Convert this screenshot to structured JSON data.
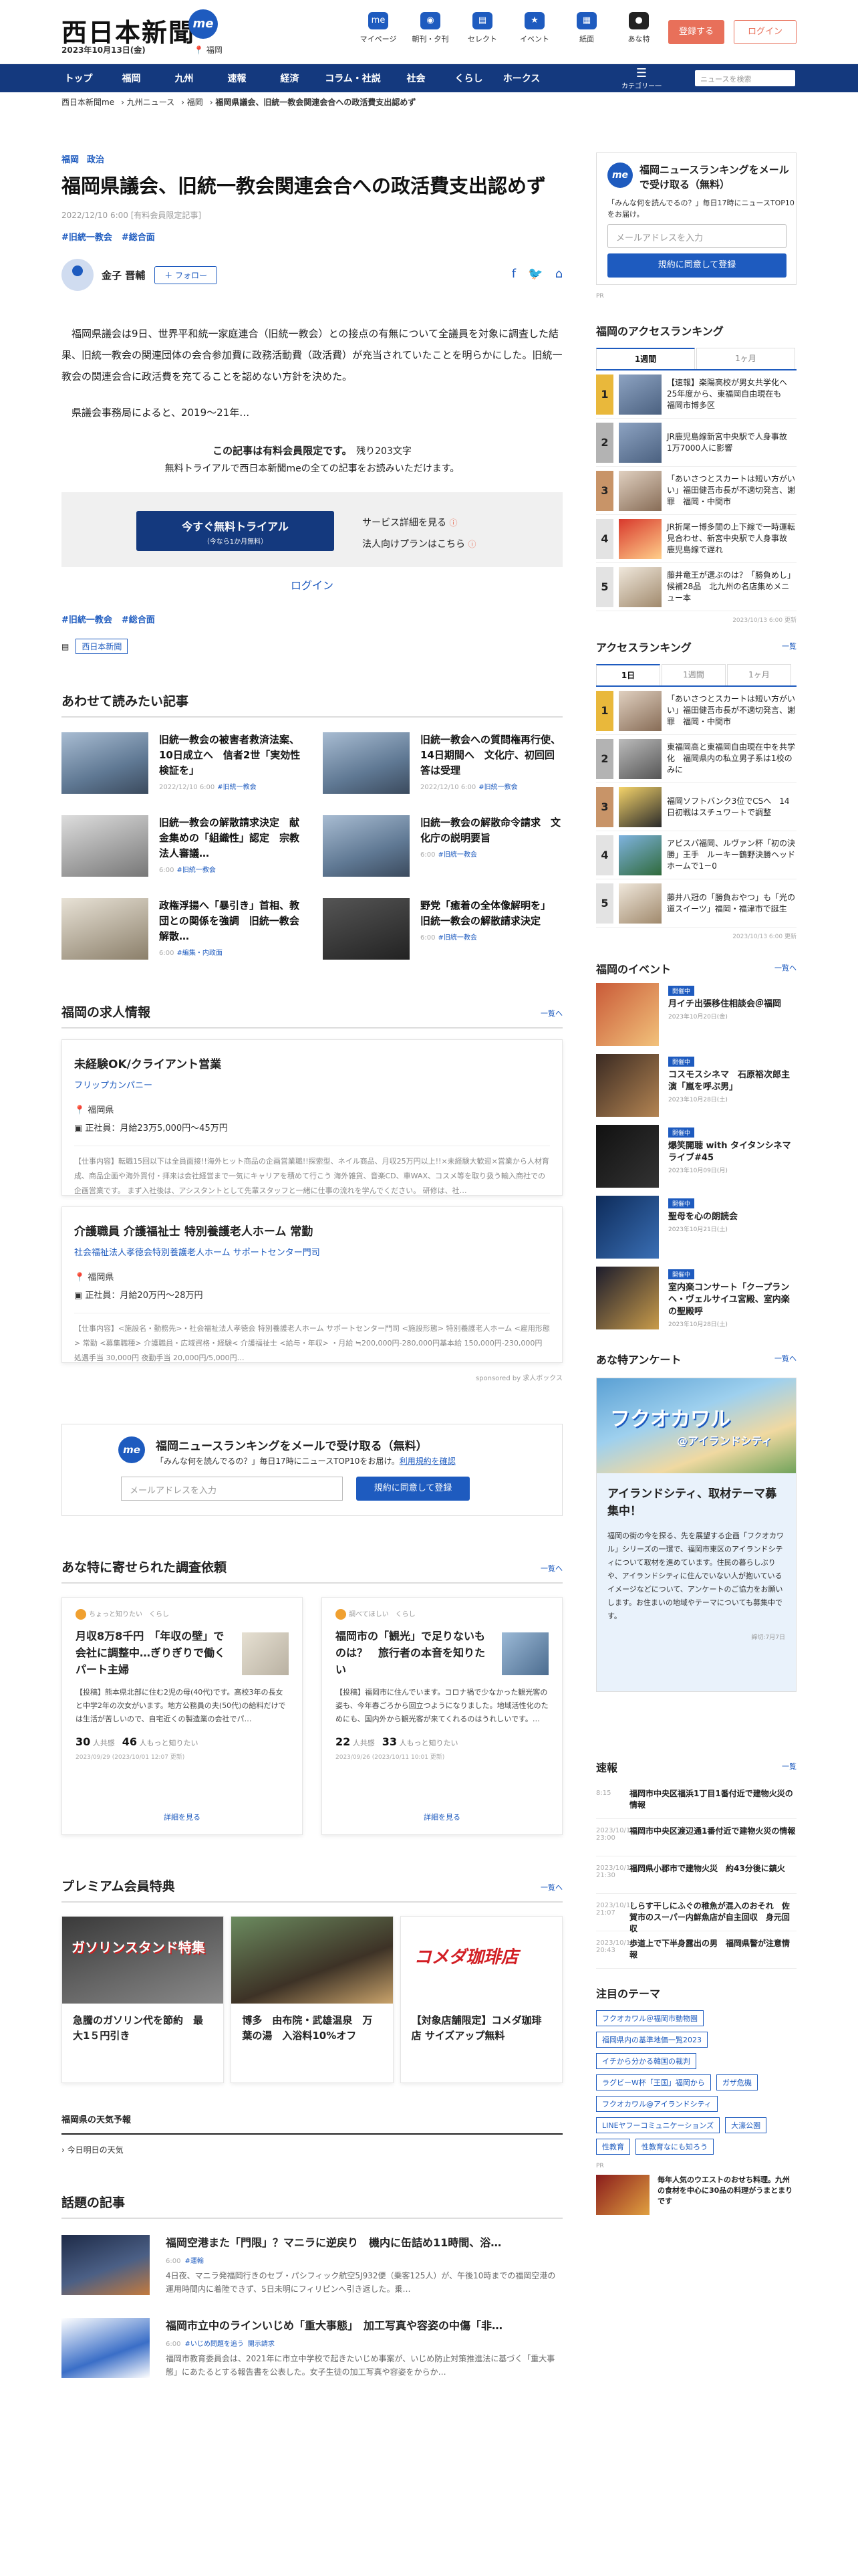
{
  "header": {
    "logo": "西日本新聞",
    "logo_me": "me",
    "date": "2023年10月13日(金)",
    "region": "福岡",
    "icons": [
      {
        "label": "マイページ",
        "icon": "user-icon"
      },
      {
        "label": "朝刊・夕刊",
        "icon": "newspaper-icon"
      },
      {
        "label": "セレクト",
        "icon": "select-icon"
      },
      {
        "label": "イベント",
        "icon": "event-icon"
      },
      {
        "label": "紙面",
        "icon": "paper-icon"
      },
      {
        "label": "あな特",
        "icon": "anatoku-icon"
      }
    ],
    "register": "登録する",
    "login": "ログイン"
  },
  "nav": {
    "items": [
      "トップ",
      "福岡",
      "九州",
      "速報",
      "経済",
      "コラム・社説",
      "社会",
      "くらし",
      "ホークス"
    ],
    "menu_label": "カテゴリー一覧",
    "search_placeholder": "ニュースを検索"
  },
  "breadcrumb": [
    "西日本新聞me",
    "九州ニュース",
    "福岡",
    "福岡県議会、旧統一教会関連会合への政活費支出認めず"
  ],
  "article": {
    "categories": [
      "福岡",
      "政治"
    ],
    "title": "福岡県議会、旧統一教会関連会合への政活費支出認めず",
    "meta": "2022/12/10 6:00 [有料会員限定記事]",
    "tags": [
      "#旧統一教会",
      "#総合面"
    ],
    "author": "金子 晋輔",
    "follow": "＋ フォロー",
    "paragraphs": [
      "福岡県議会は9日、世界平和統一家庭連合（旧統一教会）との接点の有無について全議員を対象に調査した結果、旧統一教会の関連団体の会合参加費に政務活動費（政活費）が充当されていたことを明らかにした。旧統一教会の関連会合に政活費を充てることを認めない方針を決めた。",
      "県議会事務局によると、2019～21年…"
    ],
    "pay_line1": "この記事は有料会員限定です。",
    "pay_remaining": "残り203文字",
    "pay_line2": "無料トライアルで西日本新聞meの全ての記事をお読みいただけます。",
    "trial_btn": "今すぐ無料トライアル",
    "trial_sub": "（今なら1か月無料）",
    "service_link": "サービス詳細を見る",
    "corp_link": "法人向けプランはこちら",
    "login": "ログイン",
    "tags_bottom": [
      "#旧統一教会",
      "#総合面"
    ],
    "source": "西日本新聞"
  },
  "related": {
    "title": "あわせて読みたい記事",
    "items": [
      {
        "title": "旧統一教会の被害者救済法案、10日成立へ　信者2世「実効性検証を」",
        "date": "2022/12/10 6:00",
        "tag": "#旧統一教会"
      },
      {
        "title": "旧統一教会への質問権再行使、14日期間へ　文化庁、初回回答は受理",
        "date": "2022/12/10 6:00",
        "tag": "#旧統一教会"
      },
      {
        "title": "旧統一教会の解散請求決定　献金集めの「組織性」認定　宗教法人審議…",
        "date": "6:00",
        "tag": "#旧統一教会"
      },
      {
        "title": "旧統一教会の解散命令請求　文化庁の説明要旨",
        "date": "6:00",
        "tag": "#旧統一教会"
      },
      {
        "title": "政権浮揚へ「暴引き」首相、教団との関係を強調　旧統一教会解散…",
        "date": "6:00",
        "tag": "#編集・内政面"
      },
      {
        "title": "野党「癒着の全体像解明を」　旧統一教会の解散請求決定",
        "date": "6:00",
        "tag": "#旧統一教会"
      }
    ]
  },
  "jobs": {
    "title": "福岡の求人情報",
    "more": "一覧へ",
    "items": [
      {
        "title": "未経験OK/クライアント営業",
        "company": "フリップカンパニー",
        "location": "福岡県",
        "salary": "正社員：月給23万5,000円〜45万円",
        "desc": "【仕事内容】転職15回以下は全員面接!!海外ヒット商品の企画営業職!!探索型、ネイル商品、月収25万円以上!!×未経験大歓迎×営業から人材育成、商品企画や海外買付・拝来は会社経営まで一気にキャリアを積めて行こう 海外雑貨、音楽CD、車WAX、コスメ等を取り扱う輸入商社での企画営業です。 まず入社後は、アシスタントとして先輩スタッフと一緒に仕事の流れを学んでください。 研修は、社…"
      },
      {
        "title": "介護職員 介護福祉士 特別養護老人ホーム 常勤",
        "company": "社会福祉法人孝徳会特別養護老人ホーム サポートセンター門司",
        "location": "福岡県",
        "salary": "正社員：月給20万円〜28万円",
        "desc": "【仕事内容】<施設名・勤務先>・社会福祉法人孝徳会 特別養護老人ホーム サポートセンター門司 <施設形態> 特別養護老人ホーム <雇用形態> 常勤 <募集職種> 介護職員・広域資格・経験< 介護福祉士 <給与・年収> ・月給 ≒200,000円-280,000円基本給 150,000円-230,000円 処遇手当 30,000円 夜勤手当 20,000円/5,000円…"
      }
    ],
    "sponsor": "sponsored by 求人ボックス"
  },
  "newsletter": {
    "title": "福岡ニュースランキングをメールで受け取る（無料）",
    "sub": "「みんな何を読んでるの？」毎日17時にニュースTOP10をお届け。",
    "terms": "利用規約を確認",
    "placeholder": "メールアドレスを入力",
    "submit": "規約に同意して登録"
  },
  "surveys": {
    "title": "あな特に寄せられた調査依頼",
    "more": "一覧へ",
    "items": [
      {
        "label": "ちょっと知りたい　くらし",
        "title": "月収8万8千円　「年収の壁」で会社に調整中…ぎりぎりで働くパート主婦",
        "desc": "【投稿】熊本県北部に住む2児の母(40代)です。高校3年の長女と中学2年の次女がいます。地方公務員の夫(50代)の給料だけでは生活が苦しいので、自宅近くの製造業の会社でパ…",
        "count1": "30",
        "count1_label": "人共感",
        "count2": "46",
        "count2_label": "人もっと知りたい",
        "date": "2023/09/29 (2023/10/01 12:07 更新)",
        "more": "詳細を見る"
      },
      {
        "label": "調べてほしい　くらし",
        "title": "福岡市の「観光」で足りないものは？　旅行者の本音を知りたい",
        "desc": "【投稿】福岡市に住んでいます。コロナ禍で少なかった観光客の姿も、今年春ごろから回立つようになりました。地域活性化のためにも、国内外から観光客が来てくれるのはうれしいです。…",
        "count1": "22",
        "count1_label": "人共感",
        "count2": "33",
        "count2_label": "人もっと知りたい",
        "date": "2023/09/26 (2023/10/11 10:01 更新)",
        "more": "詳細を見る"
      }
    ]
  },
  "premium": {
    "title": "プレミアム会員特典",
    "more": "一覧へ",
    "items": [
      {
        "title": "急騰のガソリン代を節約　最大1５円引き",
        "banner": "ガソリンスタンド特集"
      },
      {
        "title": "博多　由布院・武雄温泉　万葉の湯　入浴料10%オフ",
        "banner": ""
      },
      {
        "title": "【対象店舗限定】コメダ珈琲店 サイズアップ無料",
        "banner": "コメダ珈琲店"
      }
    ]
  },
  "weather": {
    "title": "福岡県の天気予報",
    "sub": "今日明日の天気"
  },
  "topics": {
    "title": "話題の記事",
    "items": [
      {
        "title": "福岡空港また「門限」？マニラに逆戻り　機内に缶詰め11時間、浴…",
        "date": "6:00",
        "tag": "#運輸",
        "desc": "4日夜、マニラ発福岡行きのセブ・パシフィック航空5J932便（乗客125人）が、午後10時までの福岡空港の運用時間内に着陸できず、5日未明にフィリピンへ引き返した。乗…"
      },
      {
        "title": "福岡市立中のラインいじめ「重大事態」　加工写真や容姿の中傷「非…",
        "date": "6:00",
        "tag": "#いじめ問題を追う",
        "tag2": "開示請求",
        "desc": "福岡市教育委員会は、2021年に市立中学校で起きたいじめ事案が、いじめ防止対策推進法に基づく「重大事態」にあたるとする報告書を公表した。女子生徒の加工写真や容姿をからか…"
      }
    ]
  },
  "sidebar": {
    "nl_title": "福岡ニュースランキングをメールで受け取る（無料）",
    "nl_sub": "「みんな何を読んでるの？」毎日17時にニュースTOP10をお届け。",
    "nl_placeholder": "メールアドレスを入力",
    "nl_submit": "規約に同意して登録",
    "pr": "PR",
    "access_title": "福岡のアクセスランキング",
    "access_tabs": [
      "1週間",
      "1ヶ月"
    ],
    "access": [
      "【速報】楽陽高校が男女共学化へ　25年度から、東福岡自由現在も　福岡市博多区",
      "JR鹿児島線新宮中央駅で人身事故　1万7000人に影響",
      "「あいさつとスカートは短い方がいい」福田健吾市長が不適切発言、謝罪　福岡・中間市",
      "JR折尾ー博多間の上下線で一時運転見合わせ、新宮中央駅で人身事故　鹿児島線で遅れ",
      "藤井竜王が選ぶのは？「勝負めし」候補28品　北九州の名店集めメニュー本"
    ],
    "access_updated": "2023/10/13 6:00 更新",
    "rank_title": "アクセスランキング",
    "rank_more": "一覧",
    "rank_tabs": [
      "1日",
      "1週間",
      "1ヶ月"
    ],
    "rank": [
      "「あいさつとスカートは短い方がいい」福田健吾市長が不適切発言、謝罪　福岡・中間市",
      "東福岡高と東福岡自由現在中を共学化　福岡県内の私立男子系は1校のみに",
      "福岡ソフトバンク3位でCSへ　14日初戦はスチュワートで調整",
      "アビスパ福岡、ルヴァン杯「初の決勝」王手　ルーキー鶴野決勝ヘッド　ホームで1－0",
      "藤井八冠の「勝負おやつ」も「光の道スイーツ」福岡・福津市で誕生"
    ],
    "rank_updated": "2023/10/13 6:00 更新",
    "events_title": "福岡のイベント",
    "events_more": "一覧へ",
    "events": [
      {
        "badge": "開催中",
        "title": "月イチ出張移住相談会＠福岡",
        "date": "2023年10月20日(金)"
      },
      {
        "badge": "開催中",
        "title": "コスモスシネマ　石原裕次郎主演「嵐を呼ぶ男」",
        "date": "2023年10月28日(土)"
      },
      {
        "badge": "開催中",
        "title": "爆笑開聴 with タイタンシネマライブ#45",
        "date": "2023年10月09日(月)"
      },
      {
        "badge": "開催中",
        "title": "聖母を心の朗読会",
        "date": "2023年10月21日(土)"
      },
      {
        "badge": "開催中",
        "title": "室内楽コンサート「クープランヘ・ヴェルサイユ宮殿、室内楽の聖殿呼",
        "date": "2023年10月28日(土)"
      }
    ],
    "survey_title": "あな特アンケート",
    "survey_more": "一覧へ",
    "survey_img_text": "フクオカワル",
    "survey_img_sub": "@アイランドシティ",
    "survey_head": "アイランドシティ、取材テーマ募集中！",
    "survey_desc": "福岡の街の今を探る、先を展望する企画「フクオカワル」シリーズの一環で、福岡市東区のアイランドシティについて取材を進めています。住民の暮らしぶりや、アイランドシティに住んでいない人が抱いているイメージなどについて、アンケートのご協力をお願いします。お住まいの地域やテーマについても募集中です。",
    "survey_date": "締切:7月7日",
    "speed_title": "速報",
    "speed_more": "一覧",
    "speed": [
      {
        "time": "8:15",
        "title": "福岡市中央区福浜1丁目1番付近で建物火災の情報"
      },
      {
        "time": "2023/10/12 23:00",
        "title": "福岡市中央区渡辺通1番付近で建物火災の情報"
      },
      {
        "time": "2023/10/12 21:30",
        "title": "福岡県小郡市で建物火災　約43分後に鎮火"
      },
      {
        "time": "2023/10/12 21:07",
        "title": "しらす干しにふぐの稚魚が混入のおそれ　佐賀市のスーパー内鮮魚店が自主回収　身元回収"
      },
      {
        "time": "2023/10/12 20:43",
        "title": "歩道上で下半身露出の男　福岡県警が注意情報"
      }
    ],
    "themes_title": "注目のテーマ",
    "themes": [
      "フクオカワル＠福岡市動物園",
      "福岡県内の基準地価一覧2023",
      "イチから分かる韓国の裁判",
      "ラグビーW杯「王国」福岡から",
      "ガザ危機",
      "フクオカワル@アイランドシティ",
      "LINEヤフーコミュニケーションズ",
      "大濠公園",
      "性教育",
      "性教育なにも知ろう"
    ],
    "themes_pr": "PR",
    "bottom_pr": "毎年人気のウエストのおせち料理。九州の食材を中心に30品の料理がうまとまりです"
  }
}
